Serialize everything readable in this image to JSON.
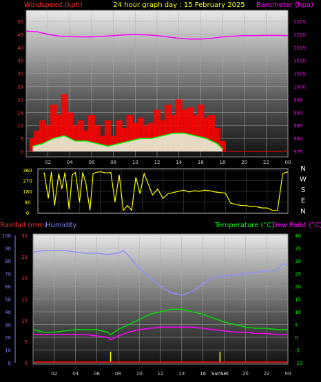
{
  "header": {
    "left_title": "Windspeed (kph)",
    "center_title": "24 hour graph day : 15 February 2025",
    "right_title": "Barometer (hpa)"
  },
  "colors": {
    "windspeed": "#ff0000",
    "gust": "#ff0000",
    "avg_wind": "#00ff00",
    "wind_fill": "#e6ffe6",
    "barometer": "#ff00ff",
    "wind_dir": "#ffff00",
    "humidity": "#8f8fff",
    "temperature": "#00dd00",
    "dewpoint": "#ff00ff",
    "rainfall": "#ff0000",
    "sun_marker": "#ffff00",
    "left_axis_text": "#ff3333",
    "pressure_axis_text": "#ff00ff",
    "humidity_axis_text": "#8888ff",
    "temp_axis_text": "#00ff00"
  },
  "chart_data": [
    {
      "type": "line",
      "name": "wind and barometer",
      "x_ticks": [
        "02",
        "04",
        "06",
        "08",
        "10",
        "12",
        "14",
        "16",
        "18",
        "20",
        "22",
        "00"
      ],
      "y_left": {
        "label": "Windspeed (kph)",
        "ticks": [
          0,
          5,
          10,
          15,
          20,
          25,
          30,
          35,
          40,
          45,
          50
        ],
        "range": [
          0,
          50
        ]
      },
      "y_right": {
        "label": "Barometer (hpa)",
        "ticks": [
          975,
          980,
          985,
          990,
          995,
          1000,
          1005,
          1010,
          1015,
          1020,
          1025
        ],
        "range": [
          975,
          1025
        ]
      },
      "x_range": [
        0,
        24
      ],
      "series": [
        {
          "key": "barometer",
          "axis": "right",
          "x": [
            0,
            1,
            2,
            3,
            4,
            5,
            6,
            7,
            8,
            9,
            10,
            11,
            12,
            13,
            14,
            15,
            16,
            17,
            18,
            19,
            20,
            21,
            22,
            23,
            24
          ],
          "values": [
            1021.2,
            1021.0,
            1020.0,
            1019.3,
            1019.1,
            1019.0,
            1019.0,
            1019.2,
            1019.5,
            1019.8,
            1019.9,
            1019.8,
            1019.5,
            1019.0,
            1018.5,
            1018.2,
            1018.2,
            1018.5,
            1019.0,
            1019.3,
            1019.5,
            1019.5,
            1019.6,
            1019.6,
            1019.5
          ]
        },
        {
          "key": "gust",
          "axis": "left",
          "x": [
            0.6,
            1.0,
            1.5,
            2.0,
            2.5,
            3.0,
            3.5,
            4.0,
            4.5,
            5.0,
            5.5,
            6.0,
            6.5,
            7.0,
            7.5,
            8.0,
            8.5,
            9.0,
            9.5,
            10.0,
            10.5,
            11.0,
            11.5,
            12.0,
            12.5,
            13.0,
            13.5,
            14.0,
            14.5,
            15.0,
            15.5,
            16.0,
            16.5,
            17.0,
            17.5,
            18.0
          ],
          "values": [
            5,
            8,
            12,
            10,
            18,
            14,
            22,
            15,
            10,
            12,
            8,
            14,
            10,
            6,
            12,
            6,
            12,
            9,
            14,
            11,
            13,
            10,
            11,
            16,
            12,
            18,
            14,
            20,
            16,
            17,
            14,
            18,
            13,
            14,
            9,
            4
          ]
        },
        {
          "key": "avg_wind",
          "axis": "left",
          "x": [
            0.6,
            1.5,
            2.5,
            3.5,
            4.5,
            5.5,
            6.5,
            7.5,
            8.5,
            9.5,
            10.5,
            11.5,
            12.5,
            13.5,
            14.5,
            15.5,
            16.5,
            17.5,
            18.0
          ],
          "values": [
            2,
            3,
            5,
            6,
            4,
            4,
            3,
            2,
            3,
            4,
            5,
            5,
            6,
            7,
            7,
            6,
            5,
            3,
            1
          ]
        }
      ]
    },
    {
      "type": "line",
      "name": "wind direction",
      "y_left": {
        "ticks": [
          0,
          90,
          180,
          270,
          360
        ],
        "range": [
          0,
          360
        ]
      },
      "y_right_labels": [
        "N",
        "W",
        "S",
        "E",
        "N"
      ],
      "x_range": [
        0,
        24
      ],
      "series": [
        {
          "key": "wind_dir",
          "x": [
            0.6,
            1.0,
            1.3,
            1.6,
            2.0,
            2.3,
            2.6,
            3.0,
            3.3,
            3.6,
            4.0,
            4.3,
            4.6,
            5.0,
            5.3,
            5.6,
            6.0,
            6.3,
            6.6,
            7.0,
            7.4,
            7.8,
            8.2,
            8.6,
            9.0,
            9.4,
            9.8,
            10.2,
            10.6,
            11.0,
            11.5,
            12.0,
            12.5,
            13.0,
            13.5,
            14.0,
            14.5,
            15.0,
            15.5,
            16.0,
            16.5,
            17.0,
            17.5,
            18.0,
            18.5,
            19.0,
            19.5,
            20.0,
            20.5,
            21.0,
            21.5,
            22.0,
            22.5,
            23.0,
            23.5,
            24.0
          ],
          "values": [
            340,
            120,
            345,
            60,
            330,
            200,
            340,
            30,
            320,
            340,
            90,
            340,
            250,
            20,
            330,
            340,
            345,
            340,
            335,
            340,
            90,
            320,
            20,
            60,
            20,
            300,
            160,
            330,
            240,
            150,
            200,
            120,
            160,
            170,
            180,
            190,
            175,
            185,
            180,
            190,
            185,
            175,
            170,
            165,
            80,
            70,
            60,
            60,
            50,
            50,
            40,
            40,
            20,
            20,
            330,
            345
          ]
        }
      ]
    },
    {
      "type": "line",
      "name": "rain humidity temperature dew point",
      "x_ticks": [
        "02",
        "04",
        "06",
        "08",
        "10",
        "12",
        "14",
        "16",
        "18",
        "20",
        "22",
        "00"
      ],
      "annotations": [
        "SunRise",
        "SunSet"
      ],
      "annotation_hours": [
        7.3,
        17.6
      ],
      "y_left_1": {
        "label": "Rainfall (mm)",
        "ticks": [
          0,
          5,
          10,
          15,
          20,
          25,
          30
        ],
        "range": [
          0,
          30
        ]
      },
      "y_left_2": {
        "label": "Humidity",
        "ticks": [
          0,
          10,
          20,
          30,
          40,
          50,
          60,
          70,
          80,
          90,
          100
        ],
        "range": [
          0,
          100
        ]
      },
      "y_right_1": {
        "label": "Temperature (°C)",
        "ticks": [
          -10,
          -5,
          0,
          5,
          10,
          15,
          20,
          25,
          30,
          35,
          40
        ],
        "range": [
          -10,
          40
        ]
      },
      "y_right_2": {
        "label": "Dew Point (°C)"
      },
      "x_range": [
        0,
        24
      ],
      "series": [
        {
          "key": "humidity",
          "axis": "humidity",
          "x": [
            0,
            1,
            2,
            3,
            4,
            5,
            6,
            7,
            8,
            8.5,
            9,
            10,
            11,
            12,
            13,
            14,
            15,
            16,
            17,
            18,
            19,
            20,
            21,
            22,
            23,
            23.5,
            24
          ],
          "values": [
            87,
            88,
            88,
            88,
            87,
            86,
            86,
            85,
            86,
            88,
            84,
            74,
            67,
            60,
            55,
            53,
            56,
            62,
            67,
            68,
            69,
            70,
            71,
            72,
            73,
            78,
            76
          ]
        },
        {
          "key": "temperature",
          "axis": "temp",
          "x": [
            0,
            1,
            2,
            3,
            4,
            5,
            6,
            7,
            7.3,
            8,
            9,
            10,
            11,
            12,
            13,
            14,
            15,
            16,
            17,
            18,
            19,
            20,
            21,
            22,
            23,
            24
          ],
          "values": [
            3,
            2,
            2,
            2.5,
            3,
            3,
            3,
            2,
            1,
            3,
            5,
            7,
            9,
            10,
            11,
            11,
            10,
            9,
            7.5,
            6,
            5,
            4,
            3.5,
            3.5,
            3,
            3
          ]
        },
        {
          "key": "dewpoint",
          "axis": "temp",
          "x": [
            0,
            1,
            2,
            3,
            4,
            5,
            6,
            7,
            7.3,
            8,
            9,
            10,
            11,
            12,
            13,
            14,
            15,
            16,
            17,
            18,
            19,
            20,
            21,
            22,
            23,
            24
          ],
          "values": [
            1,
            1,
            1,
            1,
            1,
            1,
            0.5,
            0,
            -1,
            0.5,
            2,
            3,
            3.5,
            4,
            4,
            4,
            4,
            3.5,
            3,
            2.5,
            2,
            2,
            1.5,
            1.5,
            1,
            1
          ]
        },
        {
          "key": "rainfall",
          "axis": "rain",
          "x": [
            0,
            24
          ],
          "values": [
            0,
            0
          ]
        }
      ]
    }
  ]
}
